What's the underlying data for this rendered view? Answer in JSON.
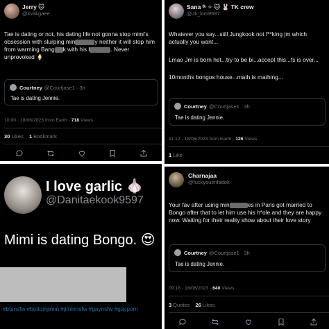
{
  "tweet_tl": {
    "author_name": "Jerry 🐱",
    "author_handle": "@kvakgaee",
    "text_1": "Tae is dating or not, his dating life not gonna stop mimi's obsession with slurping min",
    "text_1b": "y",
    "text_2": "neither it will stop him from warming Bang",
    "text_2b": "k",
    "text_3": "with his l",
    "text_3b": ". Never unprovoked 🍦",
    "quote_name": "Courtney",
    "quote_handle": "@Courtjase1 · 3h",
    "quote_text": "Tae is dating Jennie.",
    "meta_time": "10:00 · 18/06/2023 from Earth · ",
    "meta_views": "718",
    "meta_views_label": " Views",
    "likes_count": "30",
    "likes_label": "Likes",
    "bookmarks_count": "1",
    "bookmarks_label": "Bookmark"
  },
  "tweet_bl": {
    "name": "I love garlic 🧄",
    "handle": "@Danitaekook9597",
    "text": "Mimi is dating Bongo. 😍",
    "hashtags": "#btsnsfw #bottomjimin #jiminnsfw #gaynsfw #gayporn"
  },
  "tweet_tr": {
    "author_name": "Sana ᵗᵏ ✧ 🐱 🐰 TK crew",
    "author_handle": "@Jk_kim9597",
    "text_1": "Whatever you say...still Jungkook not f**king jm which actually you want...",
    "text_2": "Lmao Jm is born het...try to be bi...accept this...fs is over...",
    "text_3": "10months bongos house...math is mathing...",
    "quote_name": "Courtney",
    "quote_handle": "@Courtjase1 · 3h",
    "quote_text": "Tae is dating Jennie.",
    "meta_time": "11:12 · 18/06/2023 from Earth · ",
    "meta_views": "126",
    "meta_views_label": " Views",
    "likes_count": "1",
    "likes_label": "Like"
  },
  "tweet_br": {
    "author_name": "Charnajaa",
    "author_handle": "@fuckyouimfadok",
    "text_1": "Your fav after using min",
    "text_1b": "es in Paris got married to Bongo after that to let him use his h*ole and they are happy now. Waiting for their reality show about their love story",
    "quote_name": "Courtney",
    "quote_handle": "@Courtjase1 · 3h",
    "quote_text": "Tae is dating Jennie.",
    "meta_time": "09:18 · 18/06/2023 · ",
    "meta_views": "640",
    "meta_views_label": " Views",
    "quotes_count": "3",
    "quotes_label": "Quotes",
    "likes_count": "26",
    "likes_label": "Likes"
  },
  "icons": [
    "reply-icon",
    "retweet-icon",
    "like-icon",
    "bookmark-icon",
    "share-icon"
  ],
  "colors": {
    "background": "#000000",
    "text": "#e7e9ea",
    "muted": "#71767b",
    "divider": "#2f3336",
    "hashtag": "#1d6ea8"
  }
}
